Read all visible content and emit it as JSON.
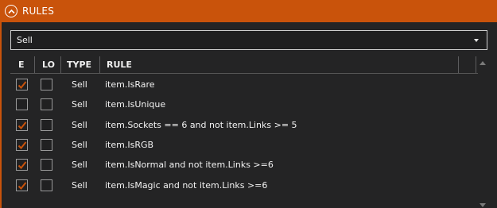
{
  "panel": {
    "title": "RULES"
  },
  "filter": {
    "selected": "Sell"
  },
  "columns": {
    "enabled": "E",
    "lo": "LO",
    "type": "TYPE",
    "rule": "RULE"
  },
  "colors": {
    "accent": "#c9530b",
    "check": "#c9530b",
    "background": "#242425"
  },
  "rows": [
    {
      "enabled": true,
      "lo": false,
      "type": "Sell",
      "rule": "item.IsRare"
    },
    {
      "enabled": false,
      "lo": false,
      "type": "Sell",
      "rule": "item.IsUnique"
    },
    {
      "enabled": true,
      "lo": false,
      "type": "Sell",
      "rule": "item.Sockets == 6 and not item.Links >= 5"
    },
    {
      "enabled": true,
      "lo": false,
      "type": "Sell",
      "rule": "item.IsRGB"
    },
    {
      "enabled": true,
      "lo": false,
      "type": "Sell",
      "rule": "item.IsNormal and not item.Links >=6"
    },
    {
      "enabled": true,
      "lo": false,
      "type": "Sell",
      "rule": "item.IsMagic and not item.Links >=6"
    }
  ]
}
